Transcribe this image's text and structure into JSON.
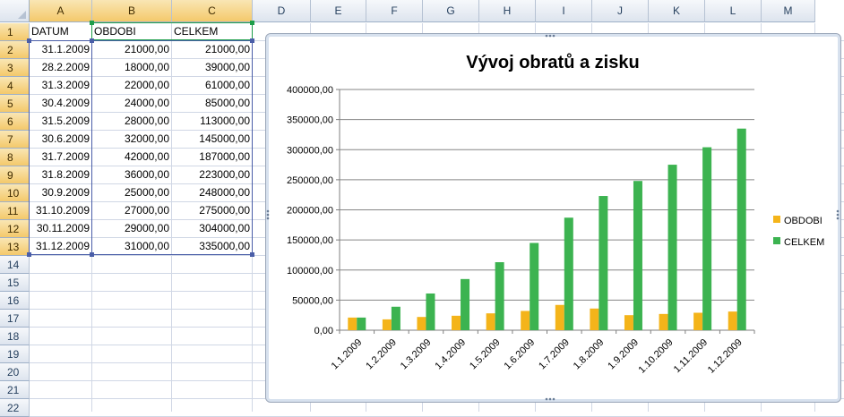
{
  "sheet": {
    "columns": [
      "A",
      "B",
      "C",
      "D",
      "E",
      "F",
      "G",
      "H",
      "I",
      "J",
      "K",
      "L",
      "M"
    ],
    "rows": [
      "1",
      "2",
      "3",
      "4",
      "5",
      "6",
      "7",
      "8",
      "9",
      "10",
      "11",
      "12",
      "13",
      "14",
      "15",
      "16",
      "17",
      "18",
      "19",
      "20",
      "21",
      "22"
    ],
    "header_row": [
      "DATUM",
      "OBDOBI",
      "CELKEM"
    ],
    "data_rows": [
      [
        "31.1.2009",
        "21000,00",
        "21000,00"
      ],
      [
        "28.2.2009",
        "18000,00",
        "39000,00"
      ],
      [
        "31.3.2009",
        "22000,00",
        "61000,00"
      ],
      [
        "30.4.2009",
        "24000,00",
        "85000,00"
      ],
      [
        "31.5.2009",
        "28000,00",
        "113000,00"
      ],
      [
        "30.6.2009",
        "32000,00",
        "145000,00"
      ],
      [
        "31.7.2009",
        "42000,00",
        "187000,00"
      ],
      [
        "31.8.2009",
        "36000,00",
        "223000,00"
      ],
      [
        "30.9.2009",
        "25000,00",
        "248000,00"
      ],
      [
        "31.10.2009",
        "27000,00",
        "275000,00"
      ],
      [
        "30.11.2009",
        "29000,00",
        "304000,00"
      ],
      [
        "31.12.2009",
        "31000,00",
        "335000,00"
      ]
    ],
    "selected_columns": [
      "A",
      "B",
      "C"
    ],
    "selected_rows": [
      "1",
      "2",
      "3",
      "4",
      "5",
      "6",
      "7",
      "8",
      "9",
      "10",
      "11",
      "12",
      "13"
    ],
    "colors": {
      "gridline": "#d0d7e5",
      "range_border": "#4a5ea8",
      "range_handle_green": "#1e9e4a"
    }
  },
  "chart_data": {
    "type": "bar",
    "title": "Vývoj obratů a zisku",
    "categories": [
      "1.1.2009",
      "1.2.2009",
      "1.3.2009",
      "1.4.2009",
      "1.5.2009",
      "1.6.2009",
      "1.7.2009",
      "1.8.2009",
      "1.9.2009",
      "1.10.2009",
      "1.11.2009",
      "1.12.2009"
    ],
    "series": [
      {
        "name": "OBDOBI",
        "color": "#f4b41a",
        "values": [
          21000,
          18000,
          22000,
          24000,
          28000,
          32000,
          42000,
          36000,
          25000,
          27000,
          29000,
          31000
        ]
      },
      {
        "name": "CELKEM",
        "color": "#3cb350",
        "values": [
          21000,
          39000,
          61000,
          85000,
          113000,
          145000,
          187000,
          223000,
          248000,
          275000,
          304000,
          335000
        ]
      }
    ],
    "ylim": [
      0,
      400000
    ],
    "y_ticks": [
      "0,00",
      "50000,00",
      "100000,00",
      "150000,00",
      "200000,00",
      "250000,00",
      "300000,00",
      "350000,00",
      "400000,00"
    ],
    "grid": true,
    "legend_position": "right"
  }
}
